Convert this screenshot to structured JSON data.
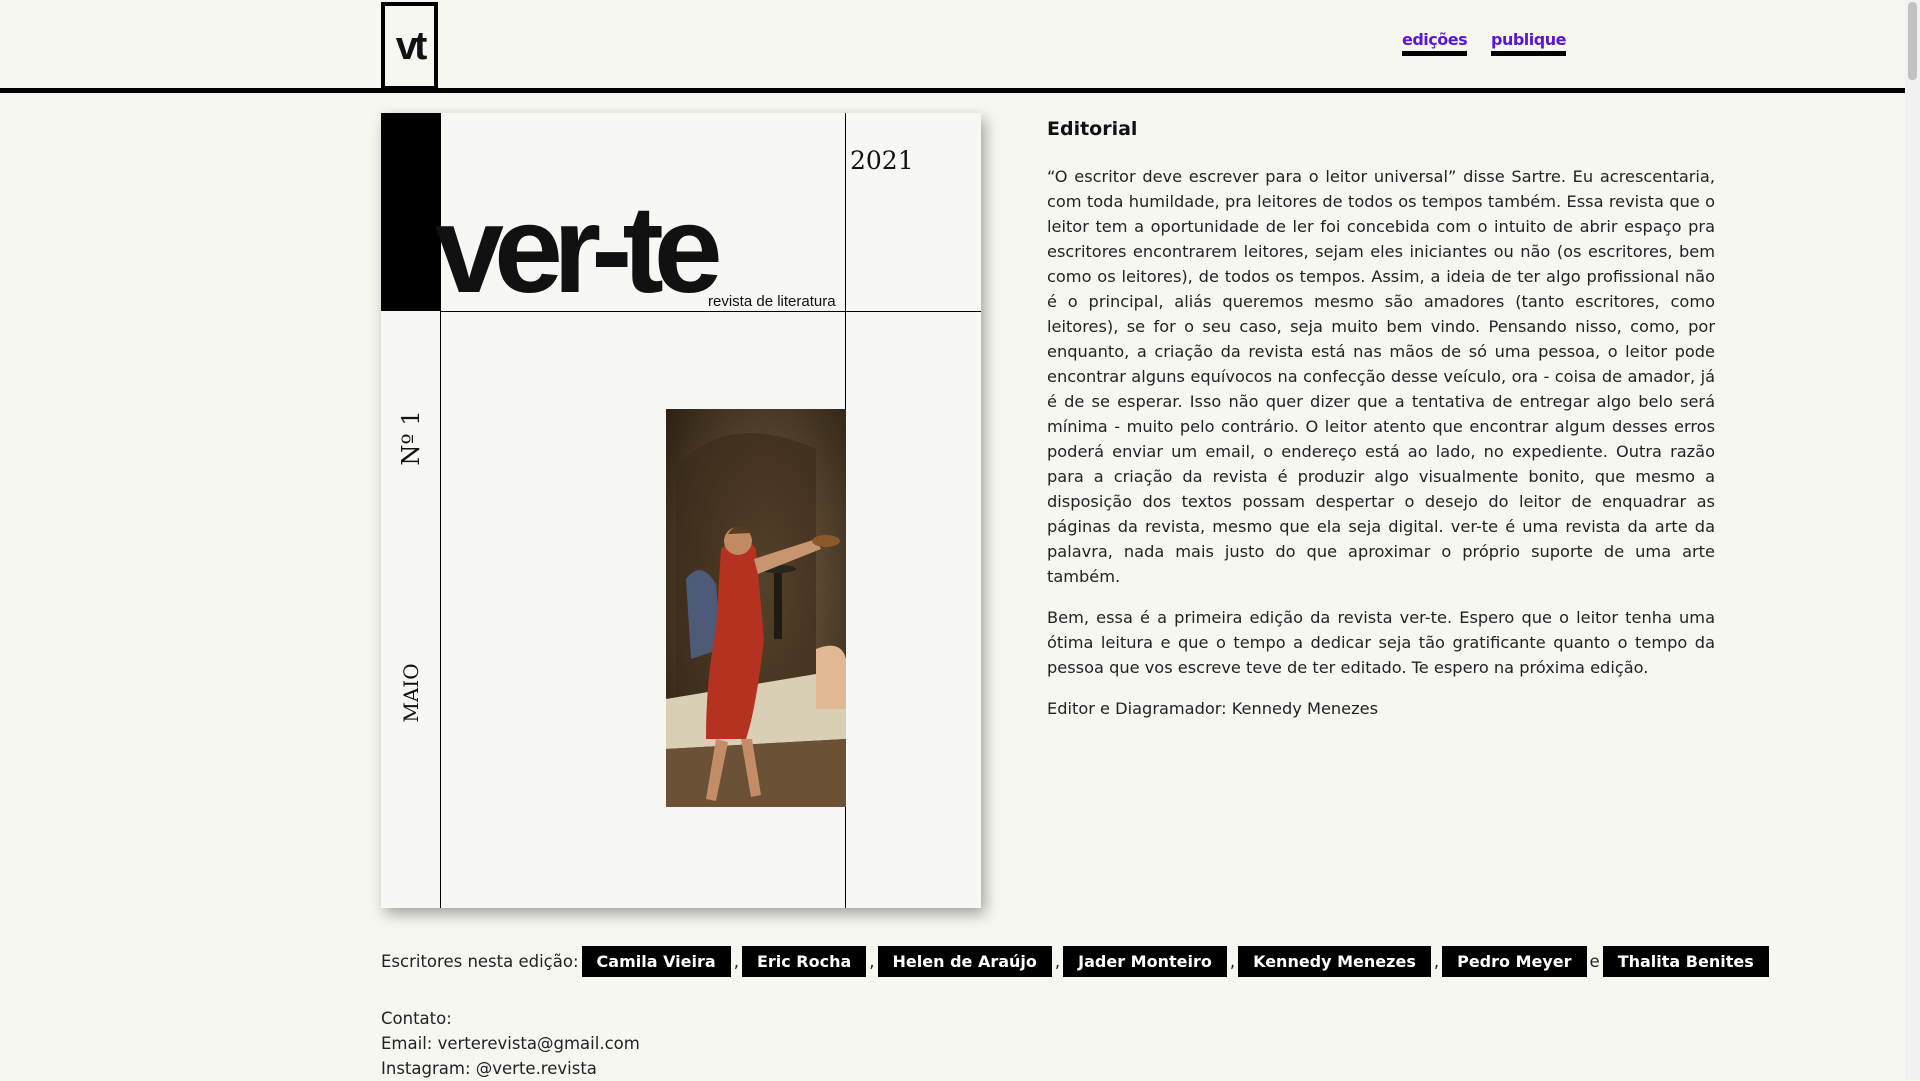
{
  "header": {
    "logo_text": "vt",
    "nav": [
      {
        "label": "edições"
      },
      {
        "label": "publique"
      }
    ]
  },
  "cover": {
    "year": "2021",
    "title": "ver-te",
    "subtitle": "revista de literatura",
    "issue_number": "Nº 1",
    "month": "MAIO"
  },
  "editorial": {
    "heading": "Editorial",
    "paragraphs": [
      "“O escritor deve escrever para o leitor universal” disse Sartre. Eu acrescentaria, com toda humildade, pra leitores de todos os tempos também. Essa revista que o leitor tem a oportunidade de ler foi concebida com o intuito de abrir espaço pra escritores encontrarem leitores, sejam eles iniciantes ou não (os escritores, bem como os leitores), de todos os tempos. Assim, a ideia de ter algo profissional não é o principal, aliás queremos mesmo são amadores (tanto escritores, como leitores), se for o seu caso, seja muito bem vindo. Pensando nisso, como, por enquanto, a criação da revista está nas mãos de só uma pessoa, o leitor pode encontrar alguns equívocos na confecção desse veículo, ora - coisa de amador, já é de se esperar. Isso não quer dizer que a tentativa de entregar algo belo será mínima - muito pelo contrário. O leitor atento que encontrar algum desses erros poderá enviar um email, o endereço está ao lado, no expediente. Outra razão para a criação da revista é produzir algo visualmente bonito, que mesmo a disposição dos textos possam despertar o desejo do leitor de enquadrar as páginas da revista, mesmo que ela seja digital. ver-te é uma revista da arte da palavra, nada mais justo do que aproximar o próprio suporte de uma arte também.",
      "Bem, essa é a primeira edição da revista ver-te. Espero que o leitor tenha uma ótima leitura e que o tempo a dedicar seja tão gratificante quanto o tempo da pessoa que vos escreve teve de ter editado. Te espero na próxima edição.",
      "Editor e Diagramador: Kennedy Menezes"
    ]
  },
  "writers": {
    "lead": "Escritores nesta edição:",
    "separator": ",",
    "conjunction": "e",
    "names": [
      "Camila Vieira",
      "Eric Rocha",
      "Helen de Araújo",
      "Jader Monteiro",
      "Kennedy Menezes",
      "Pedro Meyer",
      "Thalita Benites"
    ]
  },
  "contact": {
    "title": "Contato:",
    "email": "Email: verterevista@gmail.com",
    "instagram": "Instagram: @verte.revista"
  }
}
